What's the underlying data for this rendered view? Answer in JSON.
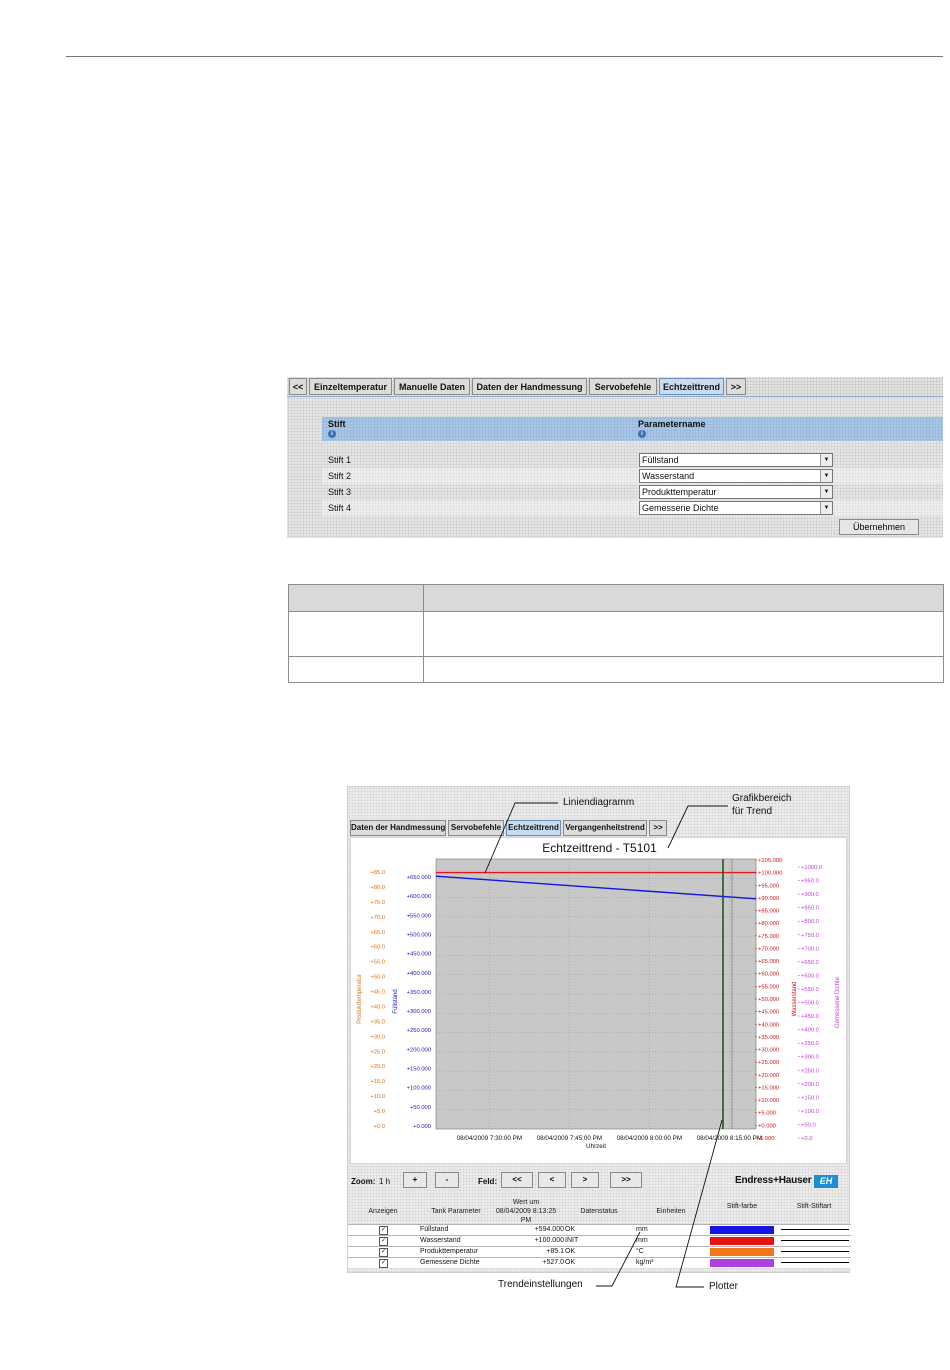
{
  "settings_panel": {
    "tabs": [
      {
        "label": "<<",
        "active": false
      },
      {
        "label": "Einzeltemperatur",
        "active": false
      },
      {
        "label": "Manuelle Daten",
        "active": false
      },
      {
        "label": "Daten der Handmessung",
        "active": false
      },
      {
        "label": "Servobefehle",
        "active": false
      },
      {
        "label": "Echtzeittrend",
        "active": true
      },
      {
        "label": ">>",
        "active": false
      }
    ],
    "header": {
      "col_pen": "Stift",
      "col_param": "Parametername"
    },
    "rows": [
      {
        "pen": "Stift 1",
        "parameter": "Füllstand"
      },
      {
        "pen": "Stift 2",
        "parameter": "Wasserstand"
      },
      {
        "pen": "Stift 3",
        "parameter": "Produkttemperatur"
      },
      {
        "pen": "Stift 4",
        "parameter": "Gemessene Dichte"
      }
    ],
    "apply_label": "Übernehmen"
  },
  "trend_panel": {
    "tabs": [
      {
        "label": "Daten der Handmessung",
        "active": false
      },
      {
        "label": "Servobefehle",
        "active": false
      },
      {
        "label": "Echtzeittrend",
        "active": true
      },
      {
        "label": "Vergangenheitstrend",
        "active": false
      },
      {
        "label": ">>",
        "active": false
      }
    ],
    "title": "Echtzeittrend - T5101",
    "zoom": {
      "label": "Zoom:",
      "value": "1 h",
      "plus": "+",
      "minus": "-",
      "field_label": "Feld:",
      "btn_first": "<<",
      "btn_prev": "<",
      "btn_next": ">",
      "btn_last": ">>"
    },
    "logo_text": "Endress+Hauser",
    "logo_mark": "EH",
    "param_table": {
      "headers": {
        "show": "Anzeigen",
        "tank_param": "Tank Parameter",
        "value_top": "Wert um",
        "value_date": "08/04/2009 8:13:25",
        "value_bottom": "PM",
        "status": "Datenstatus",
        "units": "Einheiten",
        "pen_color": "Stift-farbe",
        "pen_type": "Stift-Stiftart"
      },
      "rows": [
        {
          "checked": "✓",
          "name": "Füllstand",
          "value": "+594.000",
          "status": "OK",
          "unit": "mm",
          "color": "#1414e6"
        },
        {
          "checked": "✓",
          "name": "Wasserstand",
          "value": "+100.000",
          "status": "INIT",
          "unit": "mm",
          "color": "#e61414"
        },
        {
          "checked": "✓",
          "name": "Produkttemperatur",
          "value": "+85.1",
          "status": "OK",
          "unit": "°C",
          "color": "#f07818"
        },
        {
          "checked": "✓",
          "name": "Gemessene Dichte",
          "value": "+527.0",
          "status": "OK",
          "unit": "kg/m³",
          "color": "#b040e0"
        }
      ]
    }
  },
  "chart_data": {
    "type": "line",
    "title": "Echtzeittrend - T5101",
    "xlabel": "Uhrzeit",
    "x_ticks": [
      "08/04/2009 7:30:00 PM",
      "08/04/2009 7:45:00 PM",
      "08/04/2009 8:00:00 PM",
      "08/04/2009 8:15:00 PM"
    ],
    "axes": [
      {
        "name": "Produkttemperatur",
        "color": "#e07010",
        "ticks": [
          "+0.0",
          "+5.0",
          "+10.0",
          "+15.0",
          "+20.0",
          "+25.0",
          "+30.0",
          "+35.0",
          "+40.0",
          "+45.0",
          "+50.0",
          "+55.0",
          "+60.0",
          "+65.0",
          "+70.0",
          "+75.0",
          "+80.0",
          "+85.0"
        ]
      },
      {
        "name": "Füllstand",
        "color": "#1a1ab0",
        "ticks": [
          "+0.000",
          "+50.000",
          "+100.000",
          "+150.000",
          "+200.000",
          "+250.000",
          "+300.000",
          "+350.000",
          "+400.000",
          "+450.000",
          "+500.000",
          "+550.000",
          "+600.000",
          "+650.000"
        ]
      },
      {
        "name": "Wasserstand",
        "color": "#d01414",
        "ticks": [
          "-5.000",
          "+0.000",
          "+5.000",
          "+10.000",
          "+15.000",
          "+20.000",
          "+25.000",
          "+30.000",
          "+35.000",
          "+40.000",
          "+45.000",
          "+50.000",
          "+55.000",
          "+60.000",
          "+65.000",
          "+70.000",
          "+75.000",
          "+80.000",
          "+85.000",
          "+90.000",
          "+95.000",
          "+100.000",
          "+105.000"
        ]
      },
      {
        "name": "Gemessene Dichte",
        "color": "#c040d0",
        "ticks": [
          "+0.0",
          "+50.0",
          "+100.0",
          "+150.0",
          "+200.0",
          "+250.0",
          "+300.0",
          "+350.0",
          "+400.0",
          "+450.0",
          "+500.0",
          "+550.0",
          "+600.0",
          "+650.0",
          "+700.0",
          "+750.0",
          "+800.0",
          "+850.0",
          "+900.0",
          "+950.0",
          "+1000.0"
        ]
      }
    ],
    "series": [
      {
        "name": "Füllstand",
        "axis": "Füllstand",
        "color": "#1414e6",
        "x": [
          "08/04/2009 7:20:00 PM",
          "08/04/2009 8:20:00 PM"
        ],
        "y": [
          652,
          593
        ]
      },
      {
        "name": "Wasserstand",
        "axis": "Wasserstand",
        "color": "#e61414",
        "x": [
          "08/04/2009 7:20:00 PM",
          "08/04/2009 8:20:00 PM"
        ],
        "y": [
          100,
          100
        ]
      }
    ],
    "xlim": [
      "08/04/2009 7:20:00 PM",
      "08/04/2009 8:20:00 PM"
    ],
    "grid": true
  },
  "callouts": {
    "line_chart": "Liniendiagramm",
    "graphic_area_1": "Grafikbereich",
    "graphic_area_2": "für Trend",
    "trend_settings": "Trendeinstellungen",
    "plotter": "Plotter"
  }
}
